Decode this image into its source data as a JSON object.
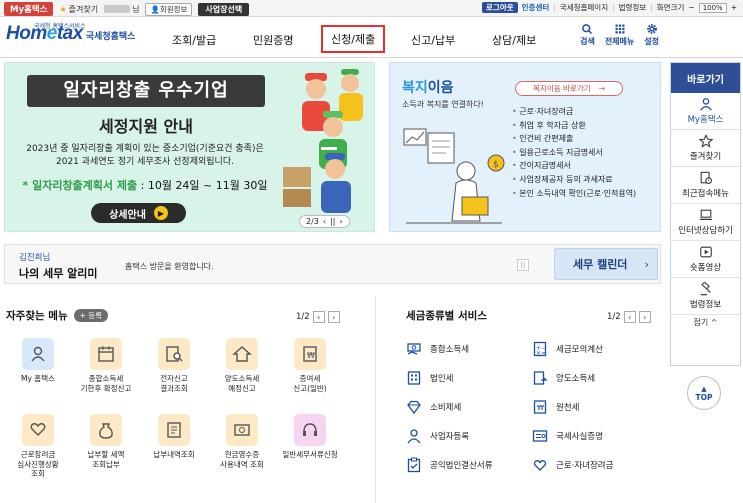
{
  "util": {
    "myhometax": "My홈택스",
    "favorites": "즐겨찾기",
    "user_suffix": "님",
    "member_info": "회원정보",
    "business_select": "사업장선택",
    "logout": "로그아웃",
    "cert_center": "인증센터",
    "nts_homepage": "국세청홈페이지",
    "legal_info": "법령정보",
    "screen_size": "화면크기",
    "zoom": "100%"
  },
  "header": {
    "logo_main": "Hometax",
    "logo_small": "국세청 홈택스서비스",
    "logo_sub": "국세청홈택스",
    "nav": [
      "조회/발급",
      "민원증명",
      "신청/제출",
      "신고/납부",
      "상담/제보"
    ],
    "active_nav": "신청/제출",
    "tools": [
      "검색",
      "전체메뉴",
      "설정"
    ]
  },
  "banner": {
    "title": "일자리창출 우수기업",
    "subtitle": "세정지원 안내",
    "desc_line1": "2023년 중 일자리창출 계획이 있는 중소기업(기준요건 충족)은",
    "desc_line2": "2021 과세연도 정기 세무조사 선정제외됩니다.",
    "date_label": "* 일자리창출계획서 제출",
    "date_value": " : 10월 24일 ~ 11월 30일",
    "button": "상세안내",
    "page": "2/3"
  },
  "welfare": {
    "title_a": "복지",
    "title_b": "이음",
    "subtitle": "소득과 복지를 연결하다!",
    "link": "복지이음 바로가기",
    "items": [
      "근로·자녀장려금",
      "취업 후 학자금 상환",
      "인건비 간편제출",
      "일용근로소득 지급명세서",
      "간이지급명세서",
      "사업장제공자 등의 과세자료",
      "본인 소득내역 확인(근로·인적용역)"
    ]
  },
  "quick": {
    "title": "바로가기",
    "items": [
      "My홈택스",
      "즐겨찾기",
      "최근접속메뉴",
      "인터넷상담하기",
      "숏폼영상",
      "법령정보"
    ],
    "fold": "접기 ^",
    "top": "TOP"
  },
  "notice": {
    "name": "김진희님",
    "title": "나의 세무 알리미",
    "message": "홈택스 방문을 환영합니다.",
    "calendar": "세무 캘린더"
  },
  "favorites": {
    "title": "자주찾는 메뉴",
    "register": "+ 등록",
    "page": "1/2",
    "items": [
      "My 홈택스",
      "종합소득세\n기한후 확정신고",
      "전자신고\n결과조회",
      "양도소득세\n예정신고",
      "증여세\n신고(일반)",
      "근로장려금\n심사진행상황\n조회",
      "납부할 세액\n조회납부",
      "납부내역조회",
      "현금영수증\n사용내역 조회",
      "일반세무서류신청"
    ]
  },
  "services": {
    "title": "세금종류별 서비스",
    "page": "1/2",
    "items": [
      "종합소득세",
      "세금모의계산",
      "법인세",
      "양도소득세",
      "소비제세",
      "원천세",
      "사업자등록",
      "국세사실증명",
      "공익법인결산서류",
      "근로·자녀장려금"
    ]
  },
  "colors": {
    "brand": "#1c4ea3",
    "quick_head": "#2e4f98",
    "myhometax_tab": "#d8413a",
    "active_outline": "#e53030",
    "banner_bg": "#d8f3e8",
    "welfare_bg": "#e2f1fb"
  }
}
